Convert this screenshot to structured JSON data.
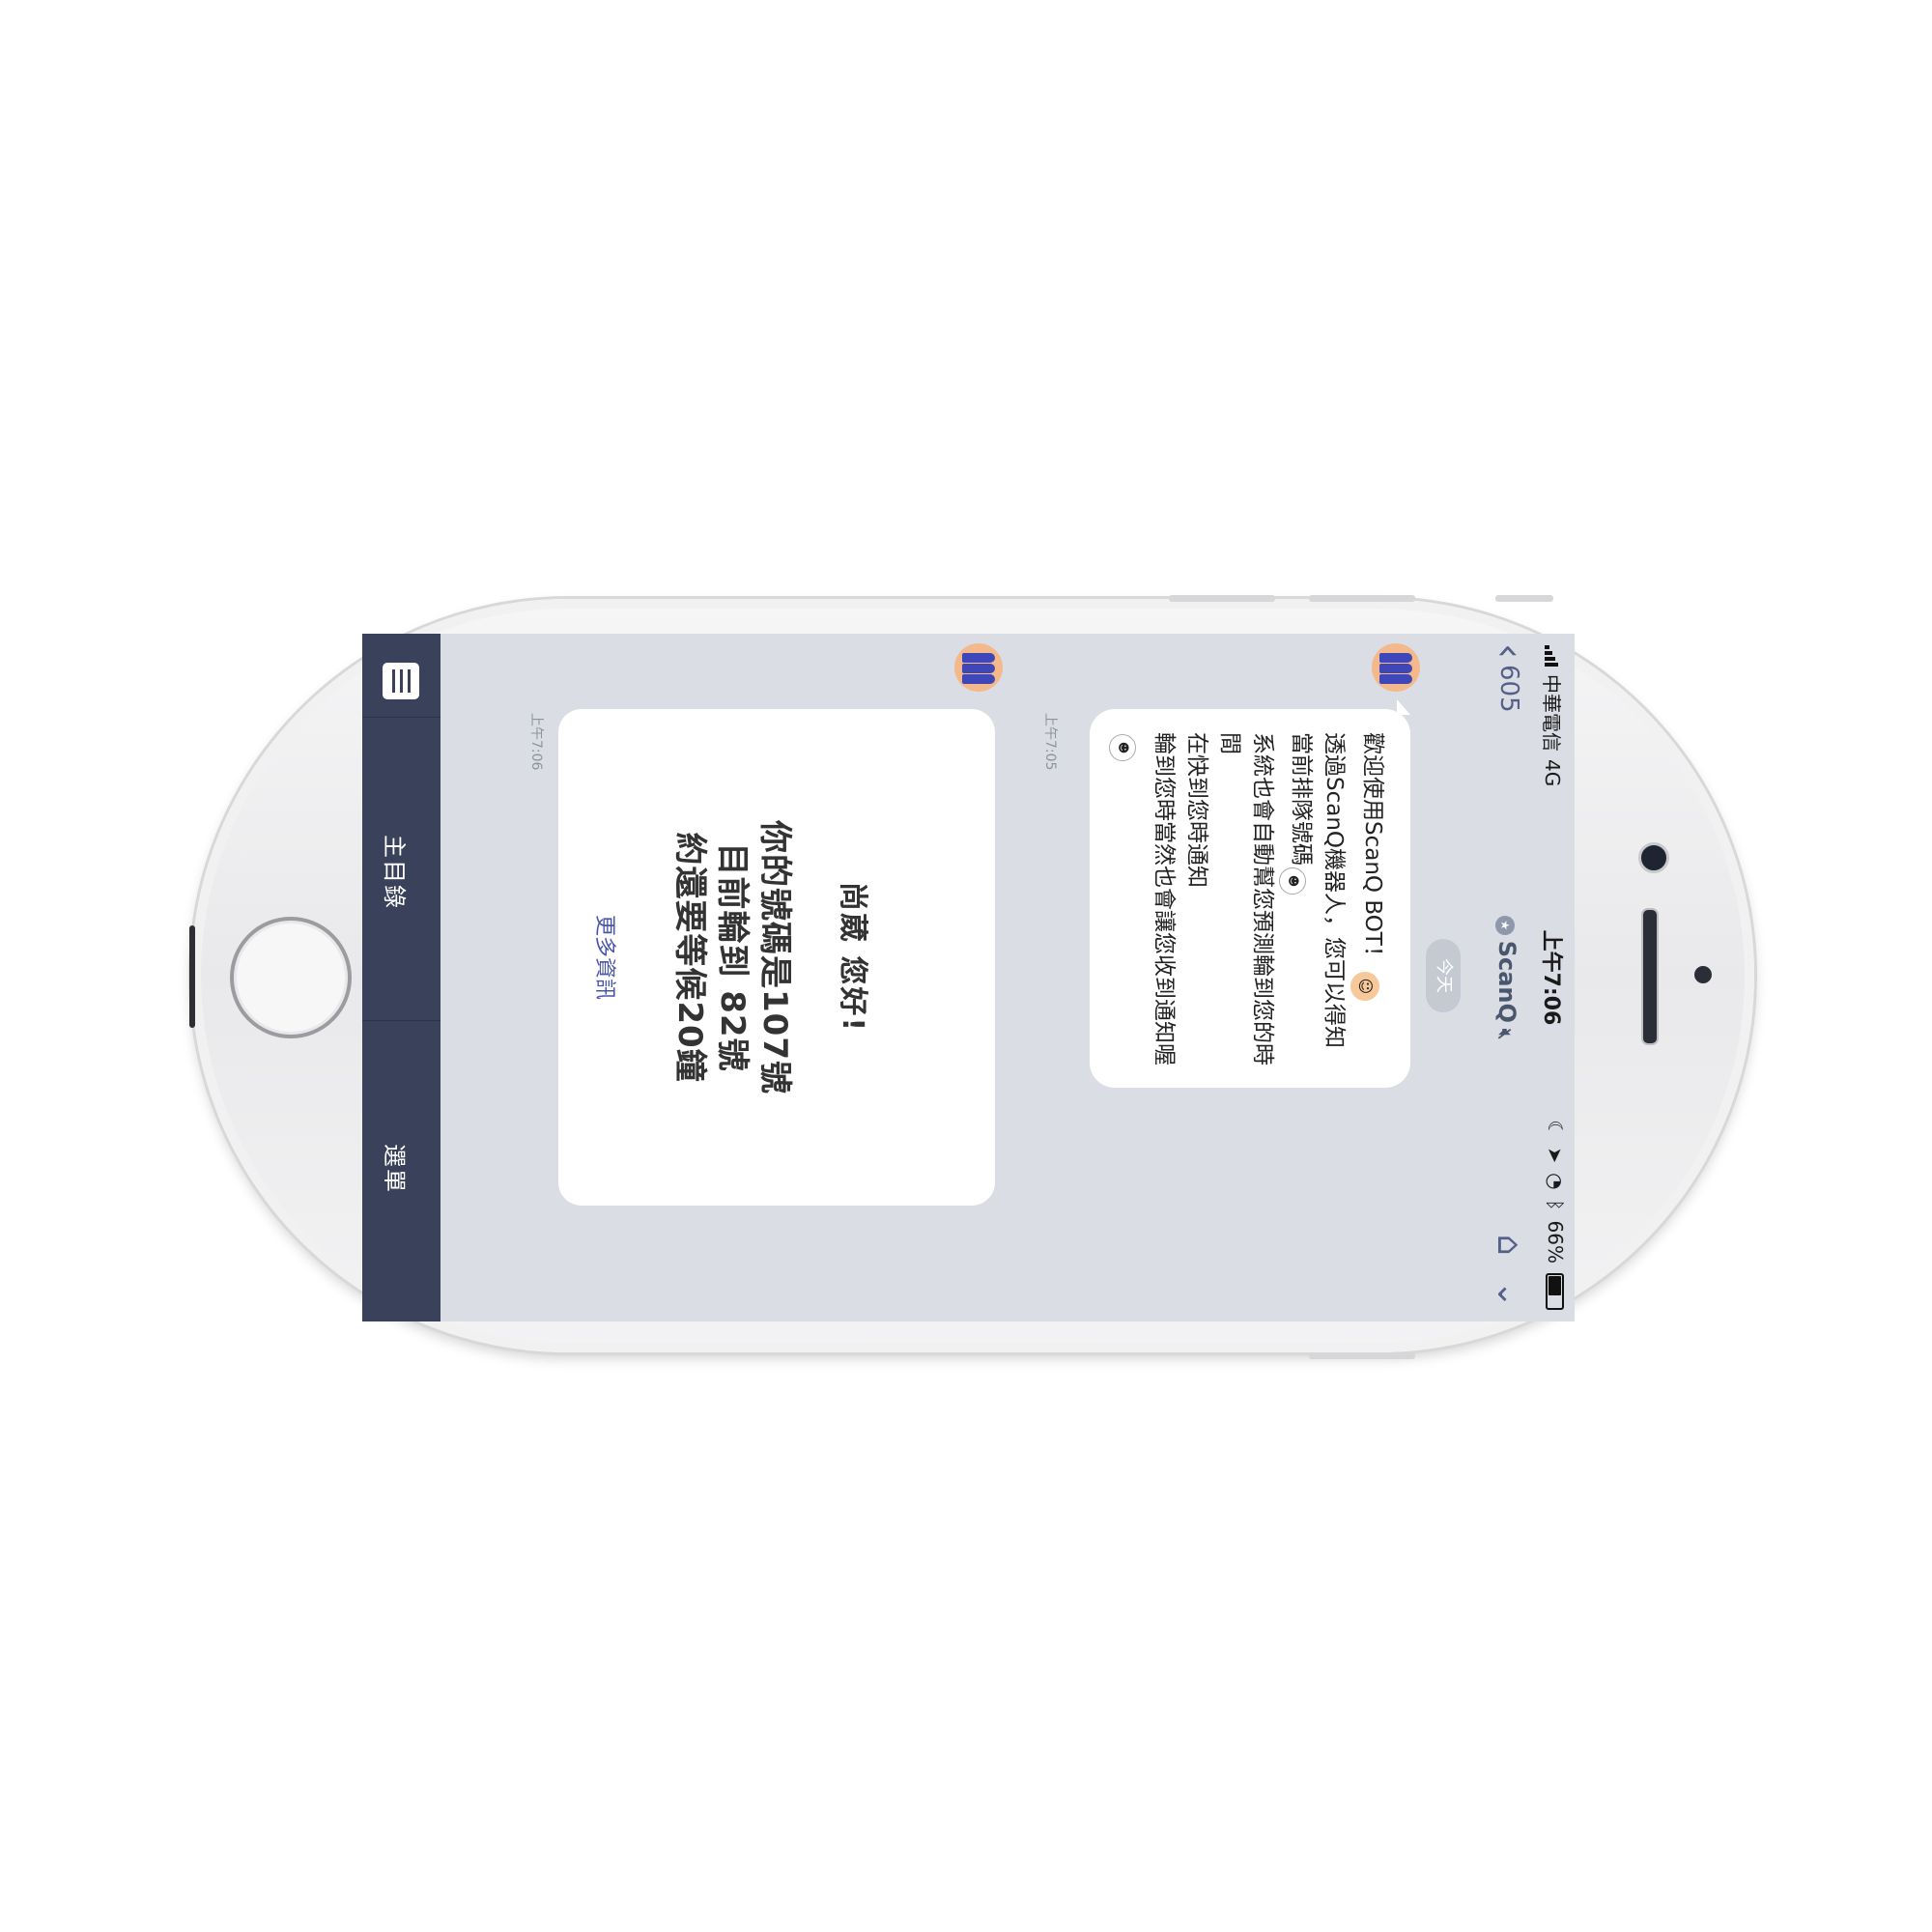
{
  "status_bar": {
    "carrier": "中華電信",
    "network": "4G",
    "time": "上午7:06",
    "battery_text": "66%",
    "battery_level": 0.66
  },
  "nav": {
    "back_count": "605",
    "title": "ScanQ",
    "icons": [
      "home-icon",
      "chevron-down-icon"
    ]
  },
  "date_divider": "今天",
  "messages": [
    {
      "lines": [
        "歡迎使用ScanQ BOT！",
        "透過ScanQ機器人，您可以得知當前排隊號碼",
        "系統也會自動幫您預測輪到您的時間",
        "在快到您時通知",
        "輪到您時當然也會讓您收到通知喔"
      ],
      "time": "上午7:05"
    }
  ],
  "card": {
    "greeting": "尚葳 您好!",
    "line1": "你的號碼是107號",
    "line2": "目前輪到 82號",
    "line3": "約還要等候20鐘",
    "link": "更多資訊",
    "time": "上午7:06"
  },
  "menu": {
    "keyboard_icon": "keyboard-icon",
    "items": [
      "主目錄",
      "選單"
    ]
  }
}
